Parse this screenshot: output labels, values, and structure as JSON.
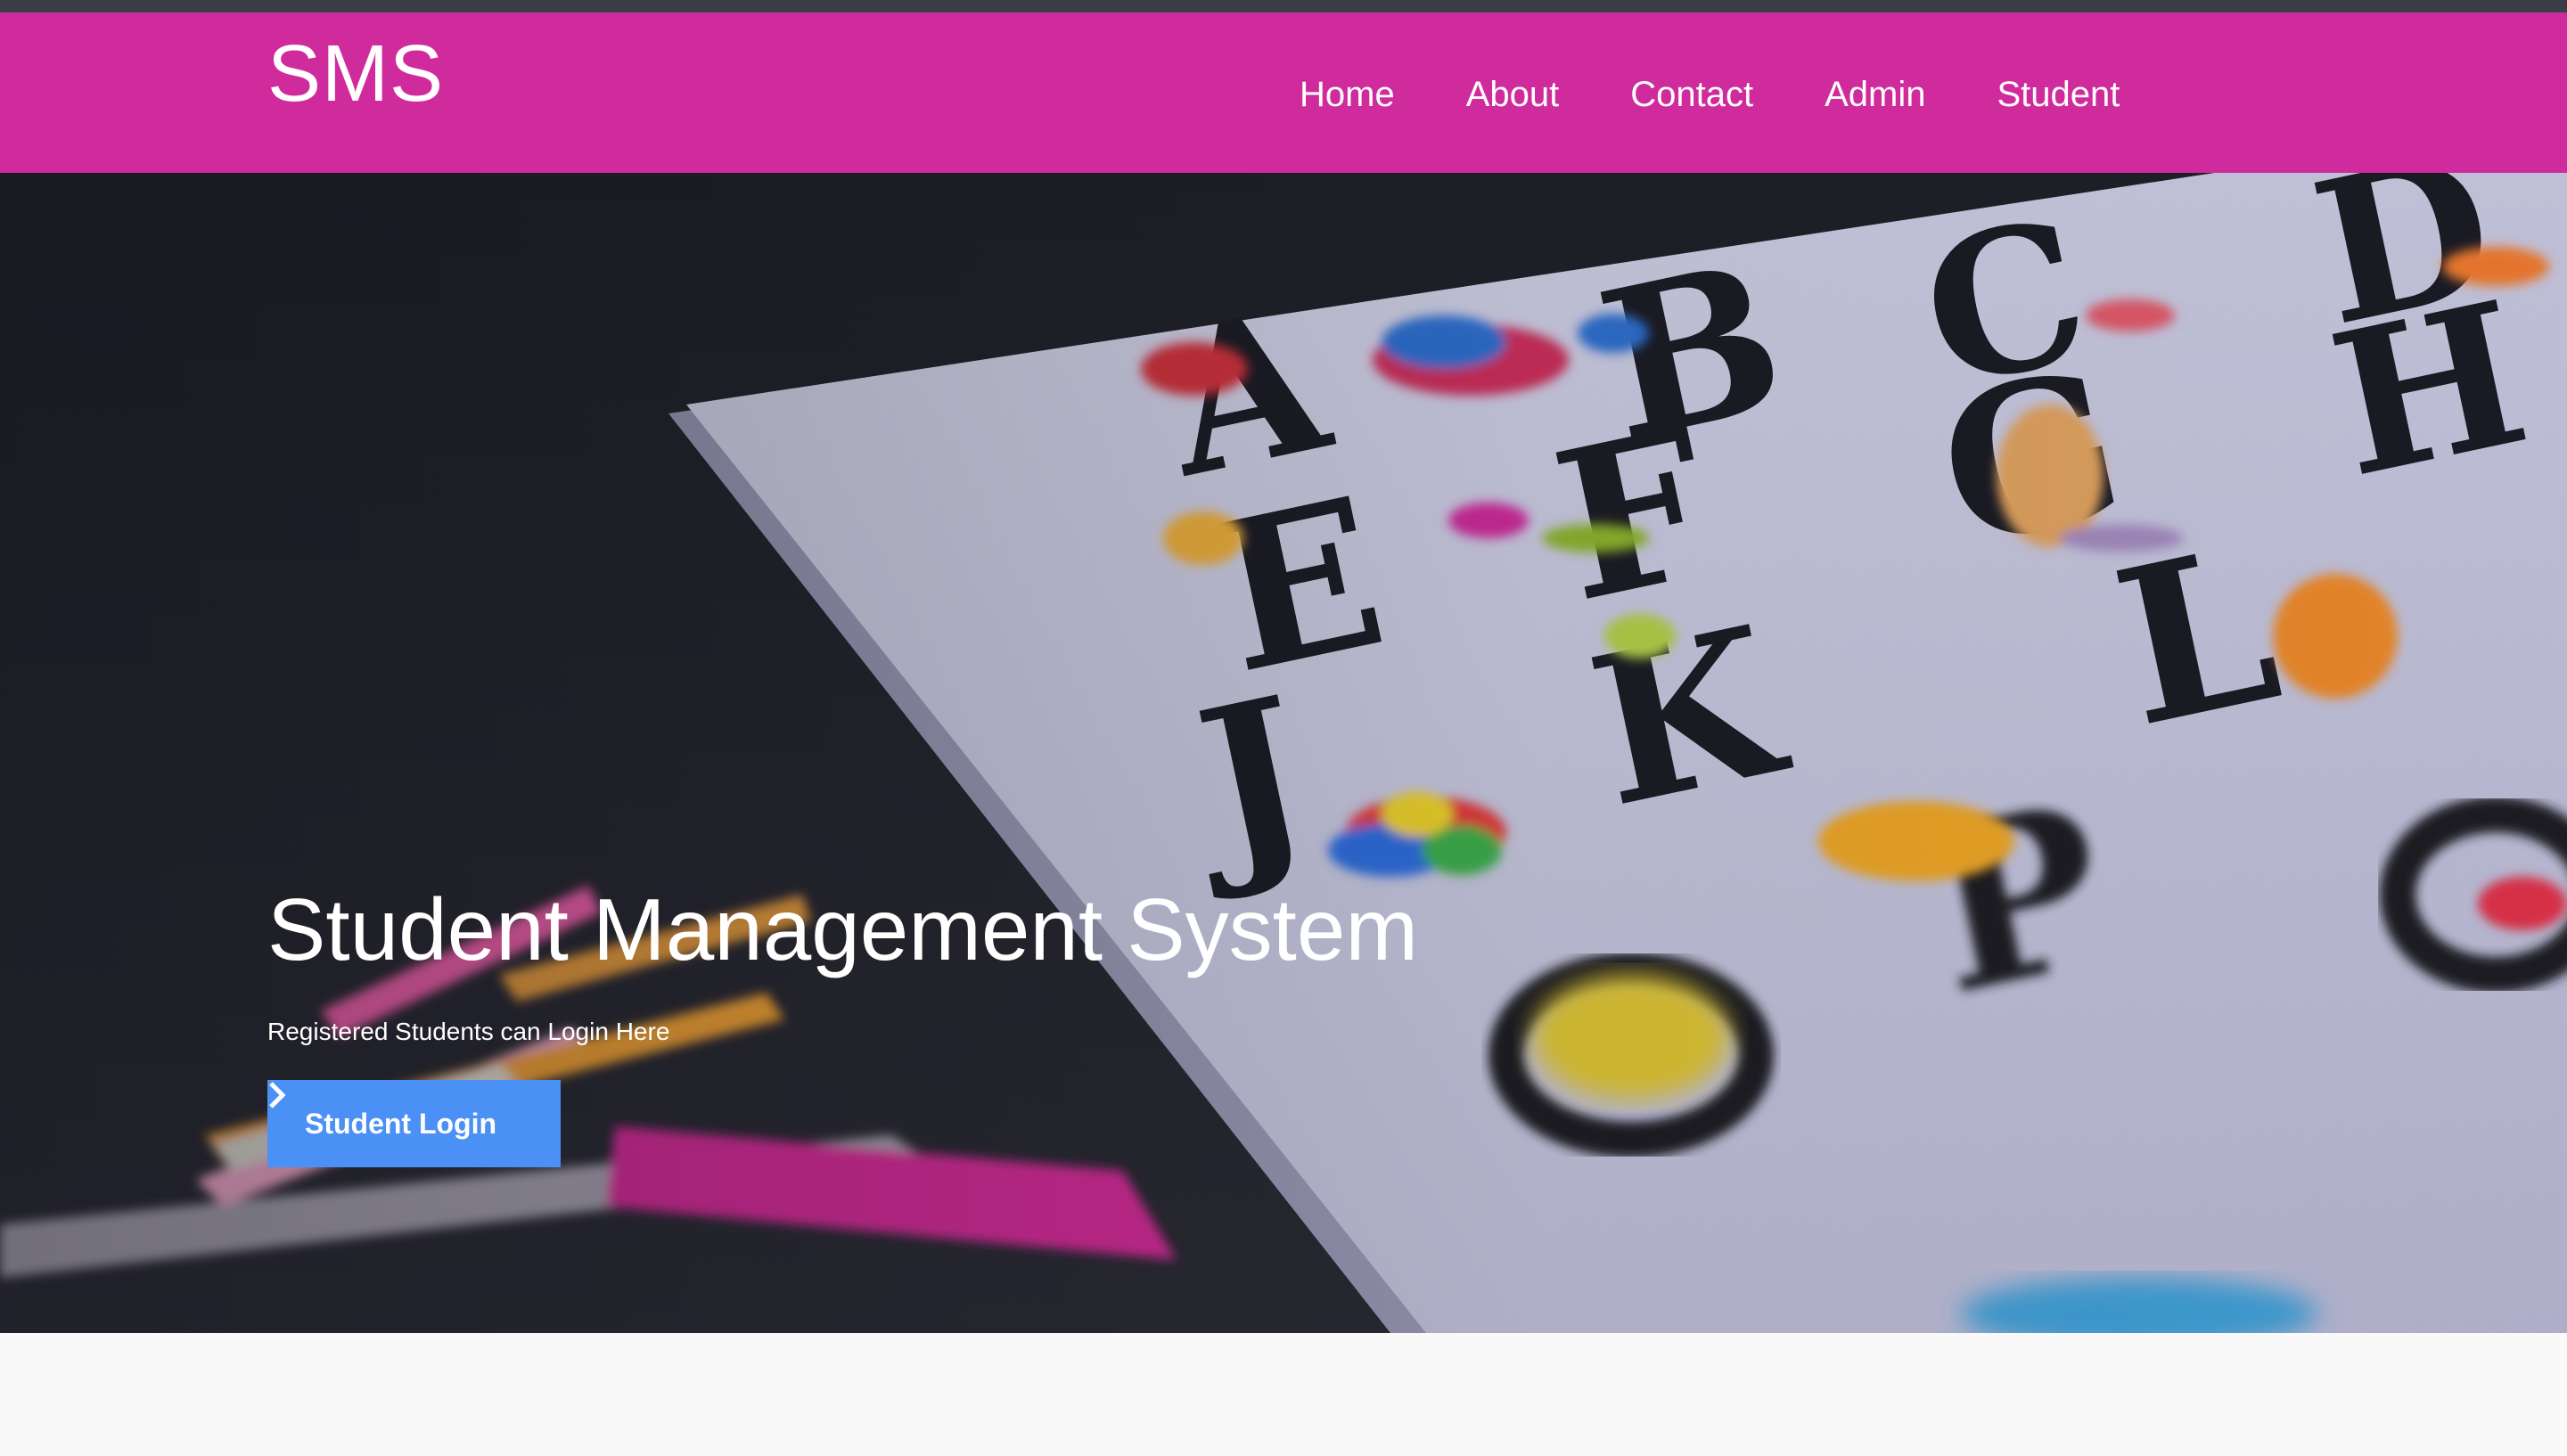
{
  "brand": "SMS",
  "nav": {
    "items": [
      {
        "label": "Home"
      },
      {
        "label": "About"
      },
      {
        "label": "Contact"
      },
      {
        "label": "Admin"
      },
      {
        "label": "Student"
      }
    ]
  },
  "hero": {
    "title": "Student Management System",
    "subtitle": "Registered Students can Login Here",
    "button_label": "Student Login",
    "button_icon": "chevron-right-icon",
    "background_image": "alphabet-chart-photo"
  },
  "colors": {
    "topbar": "#3a3d48",
    "navbar": "#d02b9c",
    "button": "#4a90f5",
    "page_bg": "#f9f9fa"
  }
}
